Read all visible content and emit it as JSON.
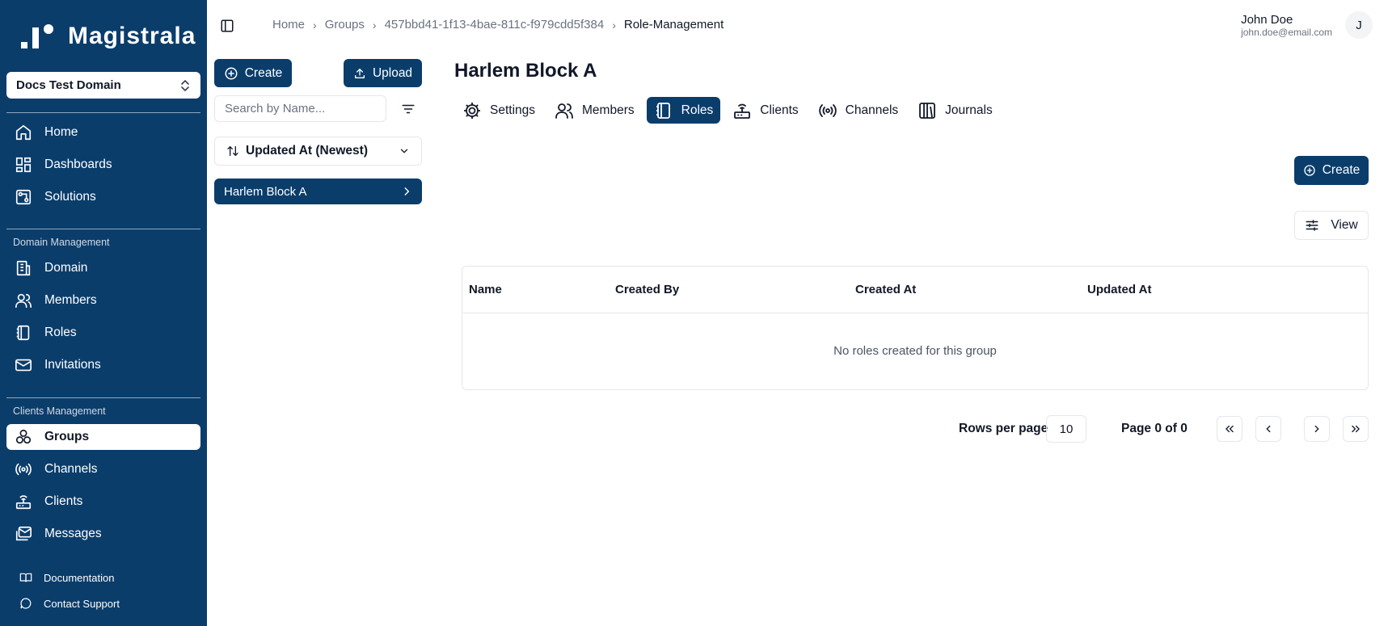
{
  "app": {
    "name": "Magistrala"
  },
  "sidebar": {
    "domain_select": "Docs Test Domain",
    "main_items": [
      {
        "label": "Home",
        "icon": "home-icon"
      },
      {
        "label": "Dashboards",
        "icon": "dashboard-icon"
      },
      {
        "label": "Solutions",
        "icon": "solutions-icon"
      }
    ],
    "domain_section": {
      "title": "Domain Management",
      "items": [
        {
          "label": "Domain",
          "icon": "domain-icon"
        },
        {
          "label": "Members",
          "icon": "members-icon"
        },
        {
          "label": "Roles",
          "icon": "roles-icon"
        },
        {
          "label": "Invitations",
          "icon": "mail-icon"
        }
      ]
    },
    "clients_section": {
      "title": "Clients Management",
      "items": [
        {
          "label": "Groups",
          "icon": "groups-icon",
          "active": true
        },
        {
          "label": "Channels",
          "icon": "channels-icon"
        },
        {
          "label": "Clients",
          "icon": "router-icon"
        },
        {
          "label": "Messages",
          "icon": "messages-icon"
        }
      ]
    },
    "footer_items": [
      {
        "label": "Documentation",
        "icon": "book-icon"
      },
      {
        "label": "Contact Support",
        "icon": "chat-icon"
      }
    ]
  },
  "breadcrumb": [
    "Home",
    "Groups",
    "457bbd41-1f13-4bae-811c-f979cdd5f384",
    "Role-Management"
  ],
  "user": {
    "name": "John Doe",
    "email": "john.doe@email.com",
    "initial": "J"
  },
  "list_panel": {
    "create_label": "Create",
    "upload_label": "Upload",
    "search_placeholder": "Search by Name...",
    "sort_label": "Updated At (Newest)",
    "items": [
      "Harlem Block A"
    ]
  },
  "main": {
    "title": "Harlem Block A",
    "tabs": [
      {
        "label": "Settings",
        "icon": "gear-icon"
      },
      {
        "label": "Members",
        "icon": "members-icon"
      },
      {
        "label": "Roles",
        "icon": "roles-icon",
        "active": true
      },
      {
        "label": "Clients",
        "icon": "router-icon"
      },
      {
        "label": "Channels",
        "icon": "channels-icon"
      },
      {
        "label": "Journals",
        "icon": "journals-icon"
      }
    ],
    "create_label": "Create",
    "view_label": "View",
    "table": {
      "columns": [
        "Name",
        "Created By",
        "Created At",
        "Updated At"
      ],
      "empty_message": "No roles created for this group"
    },
    "pagination": {
      "rows_label": "Rows per page",
      "rows_value": "10",
      "page_label": "Page 0 of 0"
    }
  },
  "colors": {
    "primary": "#0b3d6b",
    "border": "#e5e7eb",
    "muted": "#6b7280"
  }
}
